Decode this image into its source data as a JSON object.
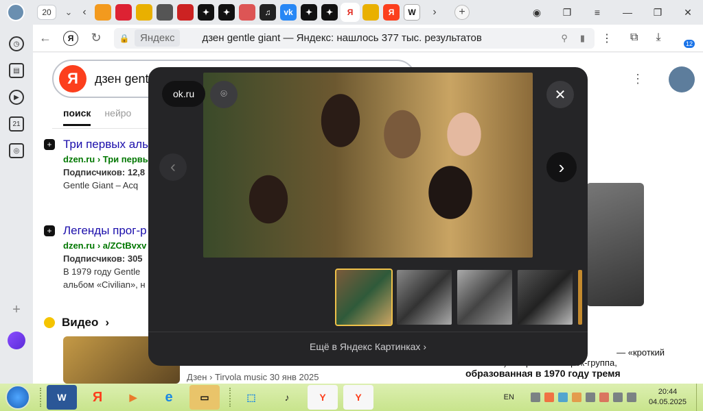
{
  "browser": {
    "tab_count": "20",
    "active_tab_favicon": "Я",
    "url_site": "Яндекс",
    "url_text": "дзен gentle giant — Яндекс: нашлось 377 тыс. результатов",
    "downloads_badge": "12",
    "favicons": [
      "‹",
      "🟠",
      "🎬",
      "⛰",
      "📄",
      "⬥",
      "✦",
      "✦",
      "👓",
      "♫",
      "vk",
      "✦",
      "✦",
      "Я",
      "⛰",
      "Я",
      "W",
      "›"
    ]
  },
  "sidebar": {
    "icons": [
      "clock-icon",
      "collections-icon",
      "play-icon",
      "calendar-icon",
      "screenshot-icon"
    ],
    "calendar_day": "21"
  },
  "search": {
    "query": "дзен gentl",
    "tabs": [
      {
        "label": "поиск",
        "active": true
      },
      {
        "label": "нейро",
        "active": false
      }
    ]
  },
  "results": [
    {
      "title": "Три первых альбома",
      "url": "dzen.ru › Три первых",
      "lines": [
        "Подписчиков: 12,8",
        "Gentle Giant – Acq"
      ]
    },
    {
      "title": "Легенды прог-р",
      "url": "dzen.ru › a/ZCtBvxv",
      "lines": [
        "Подписчиков: 305",
        "В 1979 году Gentle",
        "альбом «Civilian», н"
      ]
    }
  ],
  "video": {
    "heading": "Видео",
    "meta": "Дзен › Tirvola music   30 янв 2025"
  },
  "right_snippet": {
    "line1": "— «кроткий",
    "line2": "великан») — британская рок-группа,",
    "line3": "образованная в 1970 году тремя"
  },
  "modal": {
    "source": "ok.ru",
    "more_link": "Ещё в Яндекс Картинках ›",
    "close": "✕",
    "prev": "‹",
    "next": "›"
  },
  "taskbar": {
    "lang": "EN",
    "time": "20:44",
    "date": "04.05.2025"
  },
  "colors": {
    "yandex_red": "#fc3f1d",
    "link_blue": "#1a0dab",
    "url_green": "#007700",
    "modal_bg": "#252527",
    "taskbar": "#c8e48c"
  }
}
